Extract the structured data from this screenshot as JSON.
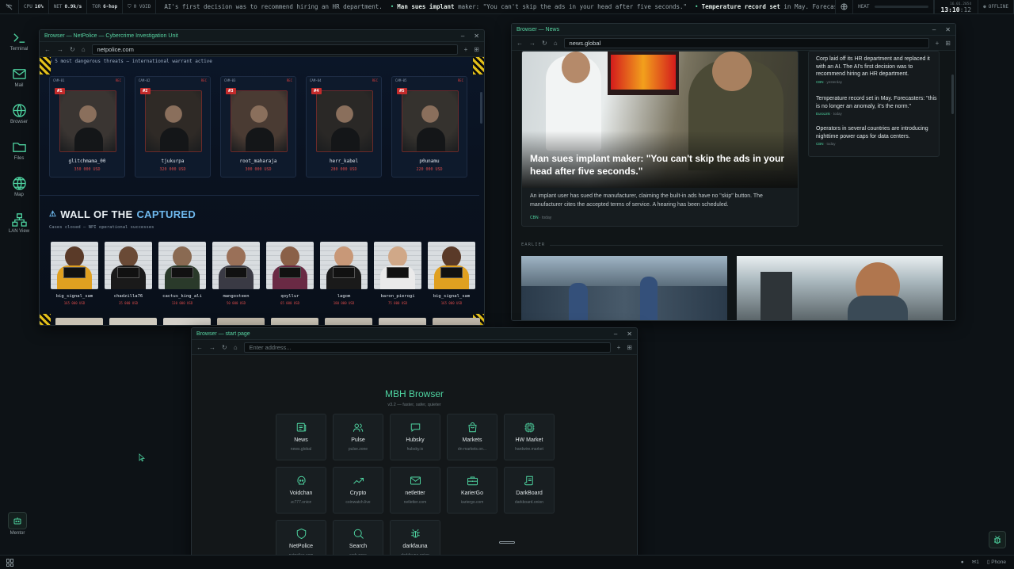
{
  "topbar": {
    "cpu_label": "CPU",
    "cpu_value": "16%",
    "net_label": "NET",
    "net_value": "0.9k/s",
    "tor_label": "TOR",
    "tor_value": "6-hop",
    "void_label": "0 VOID",
    "ticker": [
      {
        "text": "AI's first decision was to recommend hiring an HR department.",
        "bold": ""
      },
      {
        "bold": "Man sues implant",
        "text": "maker: \"You can't skip the ads in your head after five seconds.\""
      },
      {
        "bold": "Temperature record set",
        "text": "in May. Forecas"
      }
    ],
    "heat_label": "HEAT",
    "date": "16.01.2054",
    "time_main": "13:10",
    "time_sec": ":12",
    "offline_label": "OFFLINE"
  },
  "dock": [
    {
      "label": "Terminal",
      "icon": "terminal-icon"
    },
    {
      "label": "Mail",
      "icon": "mail-icon"
    },
    {
      "label": "Browser",
      "icon": "globe-icon"
    },
    {
      "label": "Files",
      "icon": "folder-icon"
    },
    {
      "label": "Map",
      "icon": "map-icon"
    },
    {
      "label": "LAN View",
      "icon": "network-icon"
    }
  ],
  "mentor_label": "Mentor",
  "bottombar": {
    "count": "1",
    "phone_label": "Phone"
  },
  "netpolice": {
    "title": "Browser — NetPolice — Cybercrime Investigation Unit",
    "url": "netpolice.com",
    "banner_text": "p 5 most dangerous threats — international warrant active",
    "wanted": [
      {
        "cam": "CAM-01",
        "rec": "REC",
        "rank": "#1",
        "name": "glitchmama_00",
        "bounty": "350 000 USD"
      },
      {
        "cam": "CAM-02",
        "rec": "REC",
        "rank": "#2",
        "name": "tjukurpa",
        "bounty": "320 000 USD"
      },
      {
        "cam": "CAM-03",
        "rec": "REC",
        "rank": "#3",
        "name": "root_maharaja",
        "bounty": "300 000 USD"
      },
      {
        "cam": "CAM-04",
        "rec": "REC",
        "rank": "#4",
        "name": "herr_kabel",
        "bounty": "280 000 USD"
      },
      {
        "cam": "CAM-05",
        "rec": "REC",
        "rank": "#5",
        "name": "p0unamu",
        "bounty": "220 000 USD"
      }
    ],
    "wall_title_a": "WALL OF THE",
    "wall_title_b": "CAPTURED",
    "wall_sub": "Cases closed — NPI operational successes",
    "captured": [
      {
        "name": "big_signal_sam",
        "bounty": "165 000 USD"
      },
      {
        "name": "chadzilla76",
        "bounty": "35 000 USD"
      },
      {
        "name": "cactus_king_ali",
        "bounty": "130 000 USD"
      },
      {
        "name": "mangosteen",
        "bounty": "50 000 USD"
      },
      {
        "name": "qoyllur",
        "bounty": "65 000 USD"
      },
      {
        "name": "lagom",
        "bounty": "180 000 USD"
      },
      {
        "name": "baron_pierogi",
        "bounty": "75 000 USD"
      },
      {
        "name": "big_signal_sam",
        "bounty": "165 000 USD"
      }
    ]
  },
  "news": {
    "title": "Browser — News",
    "url": "news.global",
    "headline": "Man sues implant maker: \"You can't skip the ads in your head after five seconds.\"",
    "lead": "An implant user has sued the manufacturer, claiming the built-in ads have no \"skip\" button. The manufacturer cites the accepted terms of service. A hearing has been scheduled.",
    "lead_source": "CBN",
    "lead_time": "today",
    "sidebar": [
      {
        "text": "Corp laid off its HR department and replaced it with an AI. The AI's first decision was to recommend hiring an HR department.",
        "source": "CBN",
        "time": "yesterday"
      },
      {
        "text": "Temperature record set in May. Forecasters: \"this is no longer an anomaly, it's the norm.\"",
        "source": "EuroLink",
        "time": "today"
      },
      {
        "text": "Operators in several countries are introducing nighttime power caps for data centers.",
        "source": "CBN",
        "time": "today"
      }
    ],
    "earlier_label": "EARLIER"
  },
  "start": {
    "title": "Browser — start page",
    "placeholder": "Enter address...",
    "heading": "MBH Browser",
    "subheading": "v3.2 — faster, safer, quieter",
    "tiles": [
      {
        "label": "News",
        "url": "news.global",
        "icon": "newspaper-icon"
      },
      {
        "label": "Pulse",
        "url": "pulse.zone",
        "icon": "users-icon"
      },
      {
        "label": "Hubsky",
        "url": "hubsky.io",
        "icon": "chat-icon"
      },
      {
        "label": "Markets",
        "url": "dn-markets.on...",
        "icon": "bag-icon"
      },
      {
        "label": "HW Market",
        "url": "hardwire.market",
        "icon": "chip-icon"
      },
      {
        "label": "Voidchan",
        "url": "vc777.onion",
        "icon": "skull-icon"
      },
      {
        "label": "Crypto",
        "url": "coinwatch.live",
        "icon": "trend-icon"
      },
      {
        "label": "netletter",
        "url": "netletter.com",
        "icon": "mail-icon"
      },
      {
        "label": "KarierGo",
        "url": "kariergo.com",
        "icon": "briefcase-icon"
      },
      {
        "label": "DarkBoard",
        "url": "darkboard.onion",
        "icon": "scroll-icon"
      },
      {
        "label": "NetPolice",
        "url": "netpolice.com",
        "icon": "shield-icon"
      },
      {
        "label": "Search",
        "url": "srch.zone",
        "icon": "search-icon"
      },
      {
        "label": "darkfauna",
        "url": "darkfauna.onion",
        "icon": "bug-icon"
      }
    ]
  }
}
